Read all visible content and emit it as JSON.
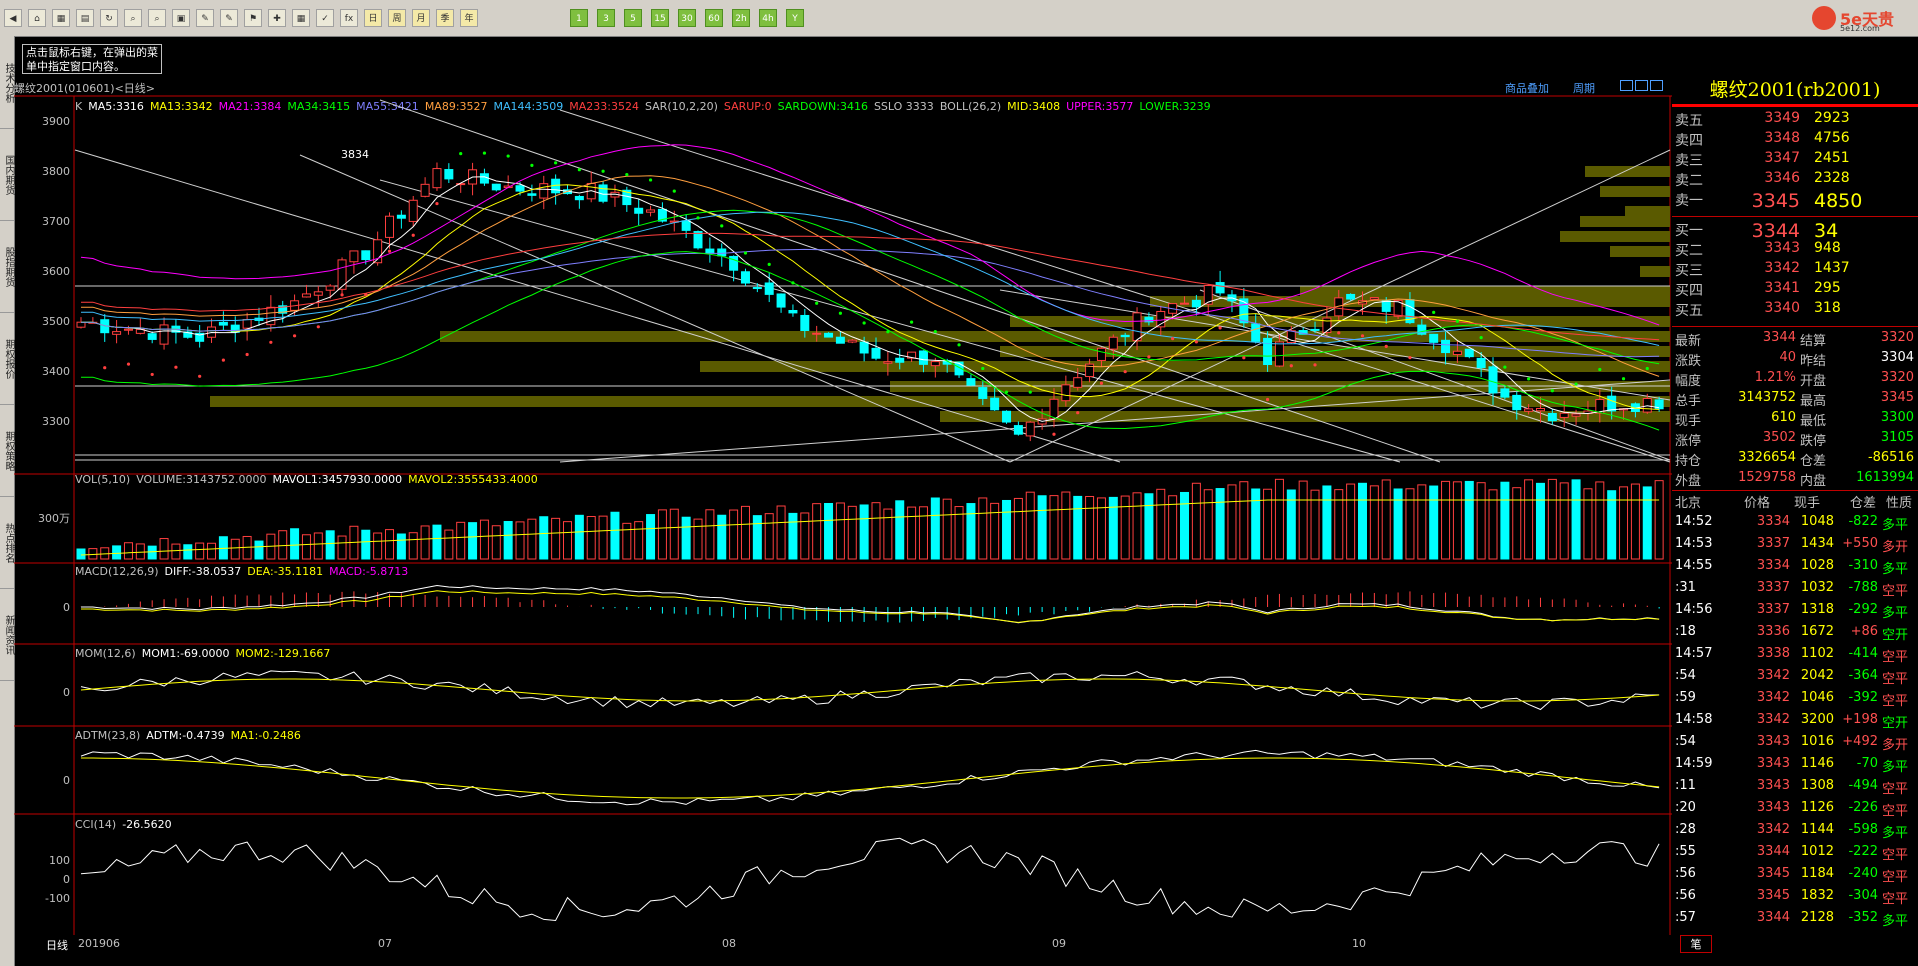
{
  "toolbar": {
    "buttons": [
      "◀",
      "⌂",
      "▦",
      "▤",
      "↻",
      "⌕",
      "⌕",
      "▣",
      "✎",
      "✎",
      "⚑",
      "✚",
      "▦",
      "✓",
      "fx",
      "日",
      "周",
      "月",
      "季",
      "年",
      "1",
      "3",
      "5",
      "15",
      "30",
      "60",
      "2h",
      "4h",
      "Y"
    ]
  },
  "logo": {
    "text": "5e天贵",
    "sub": "5e12.com"
  },
  "side_tabs": [
    "技术分析",
    "国内期货",
    "股指期货",
    "期权报价",
    "期权策略",
    "热点排名",
    "新闻资讯"
  ],
  "tooltip": "点击鼠标右键，在弹出的菜单中指定窗口内容。",
  "chart": {
    "title": "螺纹2001(010601)<日线>",
    "links": [
      "商品叠加",
      "周期"
    ],
    "legend": [
      {
        "text": "K",
        "color": "#c0c0c0"
      },
      {
        "text": "MA5:3316",
        "color": "#ffffff"
      },
      {
        "text": "MA13:3342",
        "color": "#ffff00"
      },
      {
        "text": "MA21:3384",
        "color": "#ff00ff"
      },
      {
        "text": "MA34:3415",
        "color": "#00ff00"
      },
      {
        "text": "MA55:3421",
        "color": "#7f7fff"
      },
      {
        "text": "MA89:3527",
        "color": "#ff9f3f"
      },
      {
        "text": "MA144:3509",
        "color": "#3fbfff"
      },
      {
        "text": "MA233:3524",
        "color": "#ff3f3f"
      },
      {
        "text": "SAR(10,2,20)",
        "color": "#c0c0c0"
      },
      {
        "text": "SARUP:0",
        "color": "#ff3f3f"
      },
      {
        "text": "SARDOWN:3416",
        "color": "#00ff00"
      },
      {
        "text": "SSLO 3333",
        "color": "#c0c0c0"
      },
      {
        "text": "BOLL(26,2)",
        "color": "#c0c0c0"
      },
      {
        "text": "MID:3408",
        "color": "#ffff00"
      },
      {
        "text": "UPPER:3577",
        "color": "#ff00ff"
      },
      {
        "text": "LOWER:3239",
        "color": "#00ff00"
      }
    ],
    "y_ticks": [
      "3900",
      "3800",
      "3700",
      "3600",
      "3500",
      "3400",
      "3300"
    ],
    "peak_label": "3834",
    "volume": {
      "label_parts": [
        {
          "text": "VOL(5,10)",
          "color": "#c0c0c0"
        },
        {
          "text": "VOLUME:3143752.0000",
          "color": "#c0c0c0"
        },
        {
          "text": "MAVOL1:3457930.0000",
          "color": "#ffffff"
        },
        {
          "text": "MAVOL2:3555433.4000",
          "color": "#ffff00"
        }
      ],
      "y_tick": "300万"
    },
    "macd": {
      "label_parts": [
        {
          "text": "MACD(12,26,9)",
          "color": "#c0c0c0"
        },
        {
          "text": "DIFF:-38.0537",
          "color": "#ffffff"
        },
        {
          "text": "DEA:-35.1181",
          "color": "#ffff00"
        },
        {
          "text": "MACD:-5.8713",
          "color": "#ff00ff"
        }
      ],
      "y_tick": "0"
    },
    "mom": {
      "label_parts": [
        {
          "text": "MOM(12,6)",
          "color": "#c0c0c0"
        },
        {
          "text": "MOM1:-69.0000",
          "color": "#ffffff"
        },
        {
          "text": "MOM2:-129.1667",
          "color": "#ffff00"
        }
      ],
      "y_tick": "0"
    },
    "adtm": {
      "label_parts": [
        {
          "text": "ADTM(23,8)",
          "color": "#c0c0c0"
        },
        {
          "text": "ADTM:-0.4739",
          "color": "#ffffff"
        },
        {
          "text": "MA1:-0.2486",
          "color": "#ffff00"
        }
      ],
      "y_tick": "0"
    },
    "cci": {
      "label_parts": [
        {
          "text": "CCI(14)",
          "color": "#c0c0c0"
        },
        {
          "text": "-26.5620",
          "color": "#ffffff"
        }
      ],
      "y_ticks": [
        "100",
        "0",
        "-100"
      ]
    },
    "x_axis": {
      "period_label": "日线",
      "ticks": [
        "201906",
        "07",
        "08",
        "09",
        "10"
      ]
    }
  },
  "quote": {
    "title": "螺纹2001(rb2001)",
    "asks": [
      {
        "label": "卖五",
        "price": "3349",
        "vol": "2923"
      },
      {
        "label": "卖四",
        "price": "3348",
        "vol": "4756"
      },
      {
        "label": "卖三",
        "price": "3347",
        "vol": "2451"
      },
      {
        "label": "卖二",
        "price": "3346",
        "vol": "2328"
      },
      {
        "label": "卖一",
        "price": "3345",
        "vol": "4850"
      }
    ],
    "bids": [
      {
        "label": "买一",
        "price": "3344",
        "vol": "34"
      },
      {
        "label": "买二",
        "price": "3343",
        "vol": "948"
      },
      {
        "label": "买三",
        "price": "3342",
        "vol": "1437"
      },
      {
        "label": "买四",
        "price": "3341",
        "vol": "295"
      },
      {
        "label": "买五",
        "price": "3340",
        "vol": "318"
      }
    ],
    "stats": [
      {
        "l1": "最新",
        "v1": "3344",
        "c1": "#ff5050",
        "l2": "结算",
        "v2": "3320",
        "c2": "#ff5050"
      },
      {
        "l1": "涨跌",
        "v1": "40",
        "c1": "#ff5050",
        "l2": "昨结",
        "v2": "3304",
        "c2": "#ffffff"
      },
      {
        "l1": "幅度",
        "v1": "1.21%",
        "c1": "#ff5050",
        "l2": "开盘",
        "v2": "3320",
        "c2": "#ff5050"
      },
      {
        "l1": "总手",
        "v1": "3143752",
        "c1": "#ffff00",
        "l2": "最高",
        "v2": "3345",
        "c2": "#ff5050"
      },
      {
        "l1": "现手",
        "v1": "610",
        "c1": "#ffff00",
        "l2": "最低",
        "v2": "3300",
        "c2": "#00ff00"
      },
      {
        "l1": "涨停",
        "v1": "3502",
        "c1": "#ff5050",
        "l2": "跌停",
        "v2": "3105",
        "c2": "#00ff00"
      },
      {
        "l1": "持仓",
        "v1": "3326654",
        "c1": "#ffff00",
        "l2": "仓差",
        "v2": "-86516",
        "c2": "#ffff00"
      },
      {
        "l1": "外盘",
        "v1": "1529758",
        "c1": "#ff5050",
        "l2": "内盘",
        "v2": "1613994",
        "c2": "#00ff00"
      }
    ],
    "tick_header": [
      "北京",
      "价格",
      "现手",
      "仓差",
      "性质"
    ],
    "ticks": [
      {
        "t": "14:52",
        "p": "3334",
        "v": "1048",
        "c": "-822",
        "n": "多平",
        "pc": "#ff5050",
        "cc": "#00ff00",
        "nc": "#00ff00"
      },
      {
        "t": "14:53",
        "p": "3337",
        "v": "1434",
        "c": "+550",
        "n": "多开",
        "pc": "#ff5050",
        "cc": "#ff5050",
        "nc": "#ff5050"
      },
      {
        "t": "14:55",
        "p": "3334",
        "v": "1028",
        "c": "-310",
        "n": "多平",
        "pc": "#ff5050",
        "cc": "#00ff00",
        "nc": "#00ff00"
      },
      {
        "t": ":31",
        "p": "3337",
        "v": "1032",
        "c": "-788",
        "n": "空平",
        "pc": "#ff5050",
        "cc": "#00ff00",
        "nc": "#ff5050"
      },
      {
        "t": "14:56",
        "p": "3337",
        "v": "1318",
        "c": "-292",
        "n": "多平",
        "pc": "#ff5050",
        "cc": "#00ff00",
        "nc": "#00ff00"
      },
      {
        "t": ":18",
        "p": "3336",
        "v": "1672",
        "c": "+86",
        "n": "空开",
        "pc": "#ff5050",
        "cc": "#ff5050",
        "nc": "#00ff00"
      },
      {
        "t": "14:57",
        "p": "3338",
        "v": "1102",
        "c": "-414",
        "n": "空平",
        "pc": "#ff5050",
        "cc": "#00ff00",
        "nc": "#ff5050"
      },
      {
        "t": ":54",
        "p": "3342",
        "v": "2042",
        "c": "-364",
        "n": "空平",
        "pc": "#ff5050",
        "cc": "#00ff00",
        "nc": "#ff5050"
      },
      {
        "t": ":59",
        "p": "3342",
        "v": "1046",
        "c": "-392",
        "n": "空平",
        "pc": "#ff5050",
        "cc": "#00ff00",
        "nc": "#ff5050"
      },
      {
        "t": "14:58",
        "p": "3342",
        "v": "3200",
        "c": "+198",
        "n": "空开",
        "pc": "#ff5050",
        "cc": "#ff5050",
        "nc": "#00ff00"
      },
      {
        "t": ":54",
        "p": "3343",
        "v": "1016",
        "c": "+492",
        "n": "多开",
        "pc": "#ff5050",
        "cc": "#ff5050",
        "nc": "#ff5050"
      },
      {
        "t": "14:59",
        "p": "3343",
        "v": "1146",
        "c": "-70",
        "n": "多平",
        "pc": "#ff5050",
        "cc": "#00ff00",
        "nc": "#00ff00"
      },
      {
        "t": ":11",
        "p": "3343",
        "v": "1308",
        "c": "-494",
        "n": "空平",
        "pc": "#ff5050",
        "cc": "#00ff00",
        "nc": "#ff5050"
      },
      {
        "t": ":20",
        "p": "3343",
        "v": "1126",
        "c": "-226",
        "n": "空平",
        "pc": "#ff5050",
        "cc": "#00ff00",
        "nc": "#ff5050"
      },
      {
        "t": ":28",
        "p": "3342",
        "v": "1144",
        "c": "-598",
        "n": "多平",
        "pc": "#ff5050",
        "cc": "#00ff00",
        "nc": "#00ff00"
      },
      {
        "t": ":55",
        "p": "3344",
        "v": "1012",
        "c": "-222",
        "n": "空平",
        "pc": "#ff5050",
        "cc": "#00ff00",
        "nc": "#ff5050"
      },
      {
        "t": ":56",
        "p": "3345",
        "v": "1184",
        "c": "-240",
        "n": "空平",
        "pc": "#ff5050",
        "cc": "#00ff00",
        "nc": "#ff5050"
      },
      {
        "t": ":56",
        "p": "3345",
        "v": "1832",
        "c": "-304",
        "n": "空平",
        "pc": "#ff5050",
        "cc": "#00ff00",
        "nc": "#ff5050"
      },
      {
        "t": ":57",
        "p": "3344",
        "v": "2128",
        "c": "-352",
        "n": "多平",
        "pc": "#ff5050",
        "cc": "#00ff00",
        "nc": "#00ff00"
      }
    ],
    "bottom_tab": "笔"
  }
}
